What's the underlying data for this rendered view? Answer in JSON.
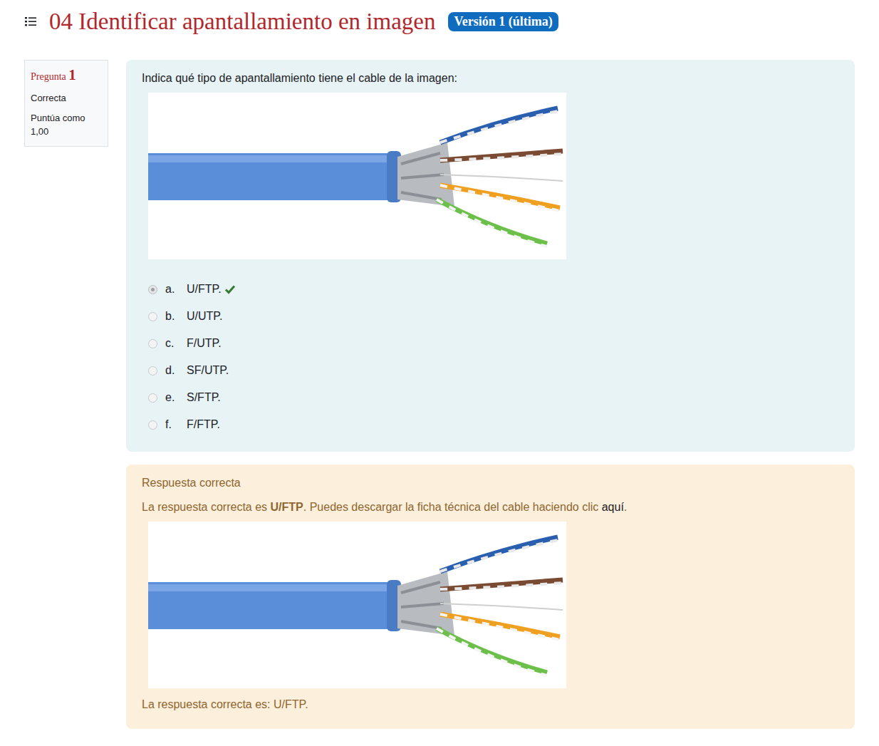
{
  "page": {
    "title": "04 Identificar apantallamiento en imagen",
    "badge": "Versión 1 (última)"
  },
  "question_info": {
    "label": "Pregunta",
    "number": "1",
    "status": "Correcta",
    "grade_label": "Puntúa como",
    "grade_value": "1,00"
  },
  "question": {
    "text": "Indica qué tipo de apantallamiento tiene el cable de la imagen:",
    "options": [
      {
        "letter": "a.",
        "text": "U/FTP.",
        "selected": true,
        "correct": true
      },
      {
        "letter": "b.",
        "text": "U/UTP.",
        "selected": false,
        "correct": false
      },
      {
        "letter": "c.",
        "text": "F/UTP.",
        "selected": false,
        "correct": false
      },
      {
        "letter": "d.",
        "text": "SF/UTP.",
        "selected": false,
        "correct": false
      },
      {
        "letter": "e.",
        "text": "S/FTP.",
        "selected": false,
        "correct": false
      },
      {
        "letter": "f.",
        "text": "F/FTP.",
        "selected": false,
        "correct": false
      }
    ]
  },
  "feedback": {
    "heading": "Respuesta correcta",
    "parts": [
      {
        "kind": "plain",
        "text": "La respuesta correcta es "
      },
      {
        "kind": "bold",
        "text": "U/FTP"
      },
      {
        "kind": "plain",
        "text": ". Puedes descargar la ficha técnica del cable haciendo clic "
      },
      {
        "kind": "link",
        "text": "aquí"
      },
      {
        "kind": "plain",
        "text": "."
      }
    ],
    "answer": "La respuesta correcta es: U/FTP."
  }
}
